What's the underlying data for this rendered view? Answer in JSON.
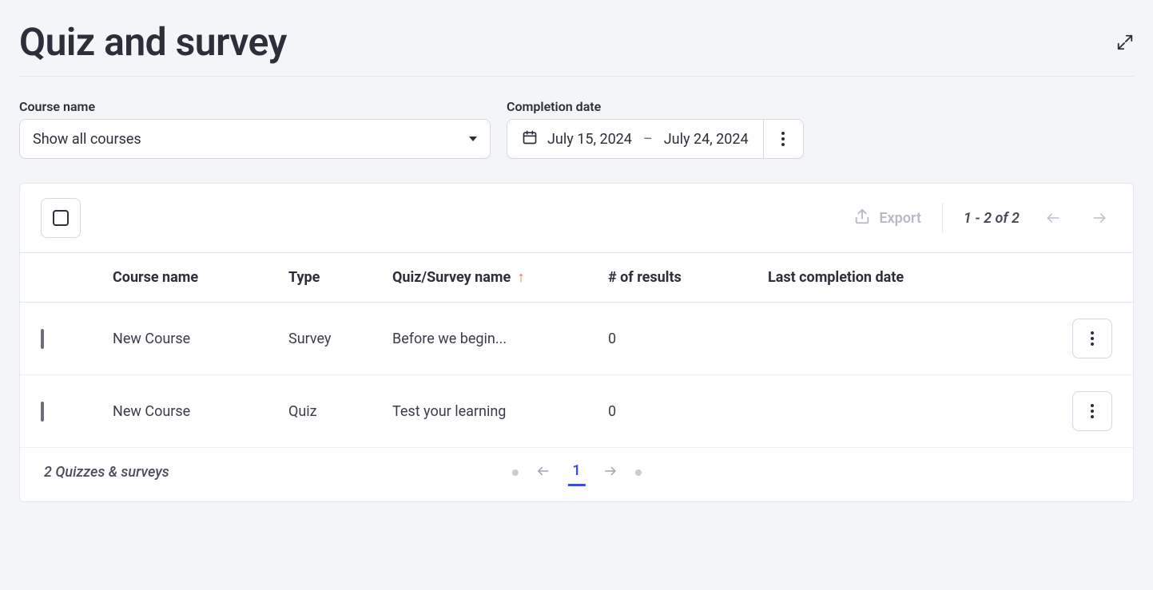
{
  "header": {
    "title": "Quiz and survey"
  },
  "filters": {
    "course_label": "Course name",
    "course_value": "Show all courses",
    "date_label": "Completion date",
    "date_start": "July 15, 2024",
    "date_end": "July 24, 2024",
    "date_separator": "–"
  },
  "toolbar": {
    "export_label": "Export",
    "range_text": "1 - 2 of 2"
  },
  "columns": {
    "course": "Course name",
    "type": "Type",
    "name": "Quiz/Survey name",
    "results": "# of results",
    "date": "Last completion date"
  },
  "rows": [
    {
      "course": "New Course",
      "type": "Survey",
      "name": "Before we begin...",
      "results": "0",
      "date": ""
    },
    {
      "course": "New Course",
      "type": "Quiz",
      "name": "Test your learning",
      "results": "0",
      "date": ""
    }
  ],
  "footer": {
    "count_text": "2 Quizzes & surveys",
    "page": "1"
  }
}
